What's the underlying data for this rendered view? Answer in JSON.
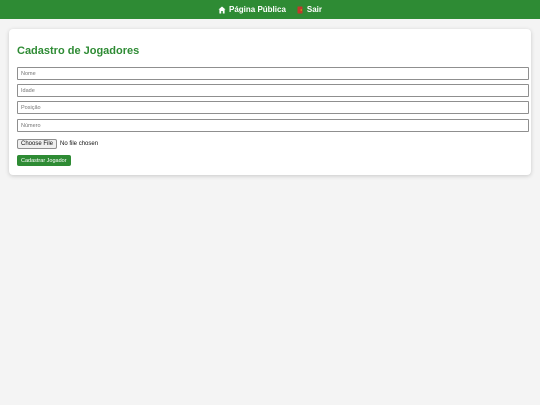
{
  "header": {
    "links": [
      {
        "label": "Página Pública",
        "icon": "house-icon"
      },
      {
        "label": "Sair",
        "icon": "door-exit-icon"
      }
    ],
    "bg_color": "#2e8b34"
  },
  "form": {
    "title": "Cadastro de Jogadores",
    "fields": {
      "nome_placeholder": "Nome",
      "idade_placeholder": "Idade",
      "posicao_placeholder": "Posição",
      "numero_placeholder": "Número"
    },
    "file": {
      "button_label": "Choose File",
      "status": "No file chosen"
    },
    "submit_label": "Cadastrar Jogador"
  },
  "colors": {
    "accent": "#2e8b34",
    "background": "#f4f4f4"
  }
}
